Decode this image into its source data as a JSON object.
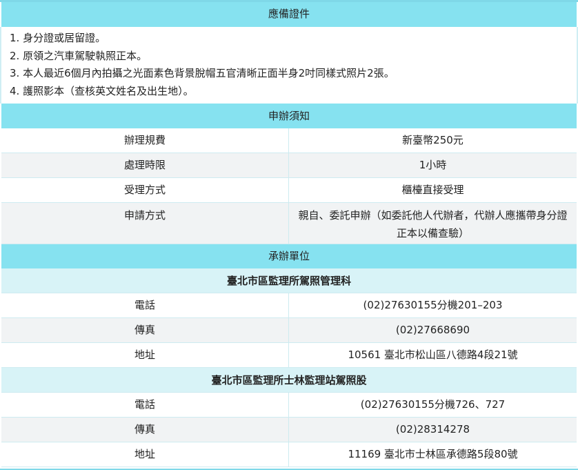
{
  "required_docs": {
    "title": "應備證件",
    "items": [
      "1. 身分證或居留證。",
      "2. 原領之汽車駕駛執照正本。",
      "3. 本人最近6個月內拍攝之光面素色背景脫帽五官清晰正面半身2吋同樣式照片2張。",
      "4. 護照影本（查核英文姓名及出生地）。"
    ]
  },
  "notice": {
    "title": "申辦須知",
    "rows": [
      {
        "label": "辦理規費",
        "value": "新臺幣250元"
      },
      {
        "label": "處理時限",
        "value": "1小時"
      },
      {
        "label": "受理方式",
        "value": "櫃檯直接受理"
      },
      {
        "label": "申請方式",
        "value": "親自、委託申辦（如委託他人代辦者，代辦人應攜帶身分證正本以備查驗）"
      }
    ]
  },
  "units": {
    "title": "承辦單位",
    "offices": [
      {
        "name": "臺北市區監理所駕照管理科",
        "rows": [
          {
            "label": "電話",
            "value": "(02)27630155分機201–203"
          },
          {
            "label": "傳真",
            "value": "(02)27668690"
          },
          {
            "label": "地址",
            "value": "10561 臺北市松山區八德路4段21號"
          }
        ]
      },
      {
        "name": "臺北市區監理所士林監理站駕照股",
        "rows": [
          {
            "label": "電話",
            "value": "(02)27630155分機726、727"
          },
          {
            "label": "傳真",
            "value": "(02)28314278"
          },
          {
            "label": "地址",
            "value": "11169 臺北市士林區承德路5段80號"
          }
        ]
      }
    ]
  }
}
